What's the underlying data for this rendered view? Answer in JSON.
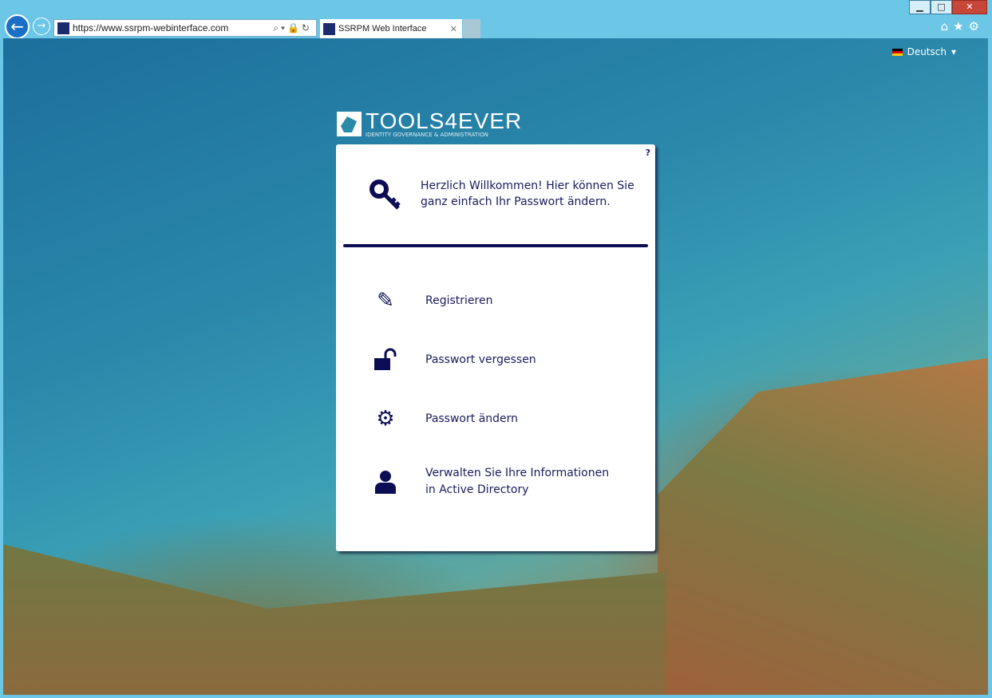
{
  "browser": {
    "url": "https://www.ssrpm-webinterface.com",
    "tab_title": "SSRPM Web Interface"
  },
  "lang": {
    "label": "Deutsch"
  },
  "logo": {
    "name": "TOOLS4EVER",
    "tagline": "IDENTITY GOVERNANCE & ADMINISTRATION"
  },
  "card": {
    "help": "?",
    "welcome": "Herzlich Willkommen! Hier können Sie ganz einfach Ihr Passwort ändern.",
    "items": [
      {
        "label": "Registrieren",
        "icon": "edit-icon"
      },
      {
        "label": "Passwort vergessen",
        "icon": "unlock-icon"
      },
      {
        "label": "Passwort ändern",
        "icon": "gears-icon"
      },
      {
        "label": "Verwalten Sie Ihre Informationen in Active Directory",
        "icon": "user-icon"
      }
    ]
  },
  "colors": {
    "accent": "#0d0d55",
    "chrome": "#6cc6e6"
  }
}
